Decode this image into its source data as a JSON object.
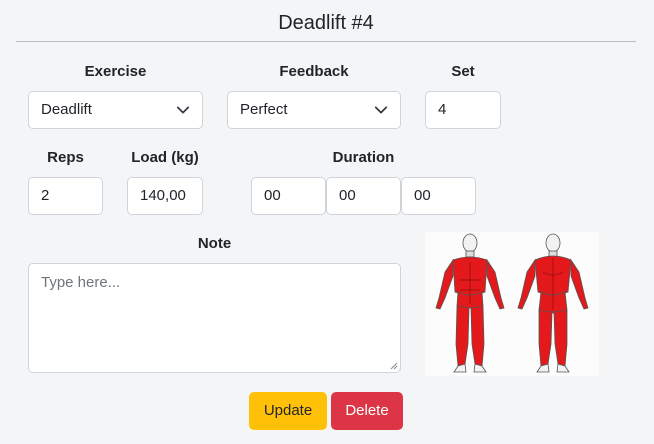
{
  "header": {
    "title": "Deadlift #4"
  },
  "form": {
    "exercise": {
      "label": "Exercise",
      "value": "Deadlift"
    },
    "feedback": {
      "label": "Feedback",
      "value": "Perfect"
    },
    "set": {
      "label": "Set",
      "value": "4"
    },
    "reps": {
      "label": "Reps",
      "value": "2"
    },
    "load": {
      "label": "Load (kg)",
      "value": "140,00"
    },
    "duration": {
      "label": "Duration",
      "hours": "00",
      "minutes": "00",
      "seconds": "00"
    },
    "note": {
      "label": "Note",
      "placeholder": "Type here..."
    }
  },
  "muscle_map": {
    "icon": "muscle-diagram-icon",
    "highlight_color": "#e3191b"
  },
  "actions": {
    "update_label": "Update",
    "delete_label": "Delete"
  },
  "colors": {
    "update": "#ffc107",
    "delete": "#dc3545"
  }
}
